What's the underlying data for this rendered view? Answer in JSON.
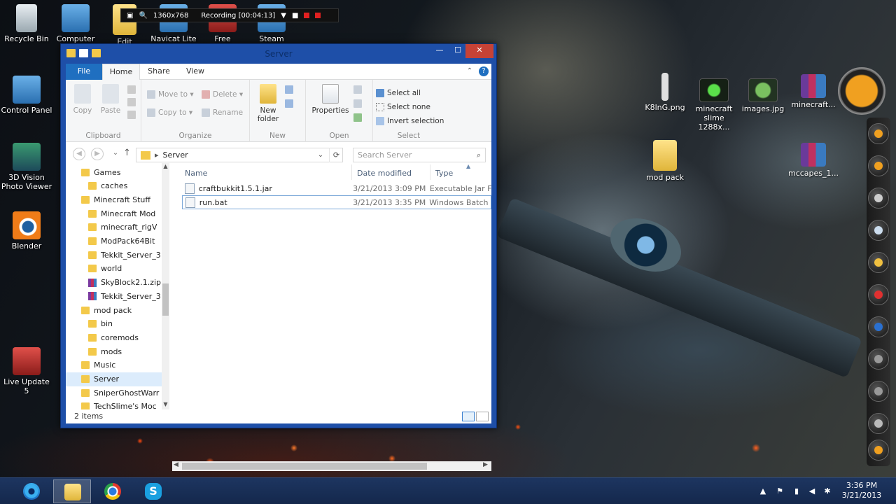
{
  "desktop": {
    "left_icons": [
      {
        "label": "Recycle Bin",
        "icon": "recycle-bin-icon"
      },
      {
        "label": "Computer",
        "icon": "computer-icon"
      },
      {
        "label": "Control Panel",
        "icon": "control-panel-icon"
      },
      {
        "label": "3D Vision Photo Viewer",
        "icon": "3d-vision-icon"
      },
      {
        "label": "Blender",
        "icon": "blender-icon"
      },
      {
        "label": "Live Update 5",
        "icon": "live-update-icon"
      }
    ],
    "top_icons": [
      {
        "label": "Edit",
        "icon": "folder-icon"
      },
      {
        "label": "Navicat Lite",
        "icon": "navicat-icon"
      },
      {
        "label": "Free",
        "icon": "free-icon"
      },
      {
        "label": "Steam",
        "icon": "steam-icon"
      }
    ],
    "right_icons": [
      {
        "label": "K8lnG.png",
        "icon": "image-file-icon"
      },
      {
        "label": "minecraft slime 1288x...",
        "icon": "image-thumb-icon"
      },
      {
        "label": "images.jpg",
        "icon": "image-thumb-icon"
      },
      {
        "label": "minecraft...",
        "icon": "rar-archive-icon"
      },
      {
        "label": "mod pack",
        "icon": "folder-icon"
      },
      {
        "label": "mccapes_1...",
        "icon": "rar-archive-icon"
      }
    ]
  },
  "recording": {
    "resolution": "1360x768",
    "status": "Recording [00:04:13]"
  },
  "window": {
    "title": "Server",
    "close_glyph": "✕",
    "min_glyph": "—",
    "max_glyph": "☐",
    "tabs": [
      "File",
      "Home",
      "Share",
      "View"
    ],
    "ribbon": {
      "clipboard": {
        "label": "Clipboard",
        "copy": "Copy",
        "paste": "Paste"
      },
      "organize": {
        "label": "Organize",
        "move_to": "Move to ▾",
        "copy_to": "Copy to ▾",
        "delete": "Delete ▾",
        "rename": "Rename"
      },
      "new": {
        "label": "New",
        "new_folder": "New folder"
      },
      "open": {
        "label": "Open",
        "properties": "Properties"
      },
      "select": {
        "label": "Select",
        "select_all": "Select all",
        "select_none": "Select none",
        "invert": "Invert selection"
      }
    },
    "address": {
      "path": "Server",
      "search_placeholder": "Search Server"
    },
    "nav_items": [
      {
        "label": "Games",
        "indent": 0,
        "type": "folder"
      },
      {
        "label": "caches",
        "indent": 1,
        "type": "folder"
      },
      {
        "label": "Minecraft Stuff",
        "indent": 0,
        "type": "folder"
      },
      {
        "label": "Minecraft Mod",
        "indent": 1,
        "type": "folder"
      },
      {
        "label": "minecraft_rigV",
        "indent": 1,
        "type": "folder"
      },
      {
        "label": "ModPack64Bit",
        "indent": 1,
        "type": "folder"
      },
      {
        "label": "Tekkit_Server_3",
        "indent": 1,
        "type": "folder"
      },
      {
        "label": "world",
        "indent": 1,
        "type": "folder"
      },
      {
        "label": "SkyBlock2.1.zip",
        "indent": 1,
        "type": "zip"
      },
      {
        "label": "Tekkit_Server_3",
        "indent": 1,
        "type": "zip"
      },
      {
        "label": "mod pack",
        "indent": 0,
        "type": "folder"
      },
      {
        "label": "bin",
        "indent": 1,
        "type": "folder"
      },
      {
        "label": "coremods",
        "indent": 1,
        "type": "folder"
      },
      {
        "label": "mods",
        "indent": 1,
        "type": "folder"
      },
      {
        "label": "Music",
        "indent": 0,
        "type": "folder"
      },
      {
        "label": "Server",
        "indent": 0,
        "type": "folder",
        "selected": true
      },
      {
        "label": "SniperGhostWarr",
        "indent": 0,
        "type": "folder"
      },
      {
        "label": "TechSlime's Moc",
        "indent": 0,
        "type": "folder"
      }
    ],
    "columns": {
      "name": "Name",
      "date": "Date modified",
      "type": "Type"
    },
    "files": [
      {
        "name": "craftbukkit1.5.1.jar",
        "date": "3/21/2013 3:09 PM",
        "type": "Executable Jar File"
      },
      {
        "name": "run.bat",
        "date": "3/21/2013 3:35 PM",
        "type": "Windows Batch File",
        "selected": true
      }
    ],
    "status": "2 items"
  },
  "taskbar": {
    "apps": [
      {
        "name": "Internet Explorer",
        "icon": "ie-icon",
        "active": false
      },
      {
        "name": "File Explorer",
        "icon": "explorer-icon",
        "active": true
      },
      {
        "name": "Google Chrome",
        "icon": "chrome-icon",
        "active": false
      },
      {
        "name": "Skype",
        "icon": "skype-icon",
        "active": false
      }
    ],
    "skype_glyph": "S",
    "time": "3:36 PM",
    "date": "3/21/2013"
  },
  "colors": {
    "window_frame": "#1e4fa8",
    "file_tab": "#1f6fc0",
    "close_button": "#c74236",
    "taskbar": "#14284c"
  }
}
